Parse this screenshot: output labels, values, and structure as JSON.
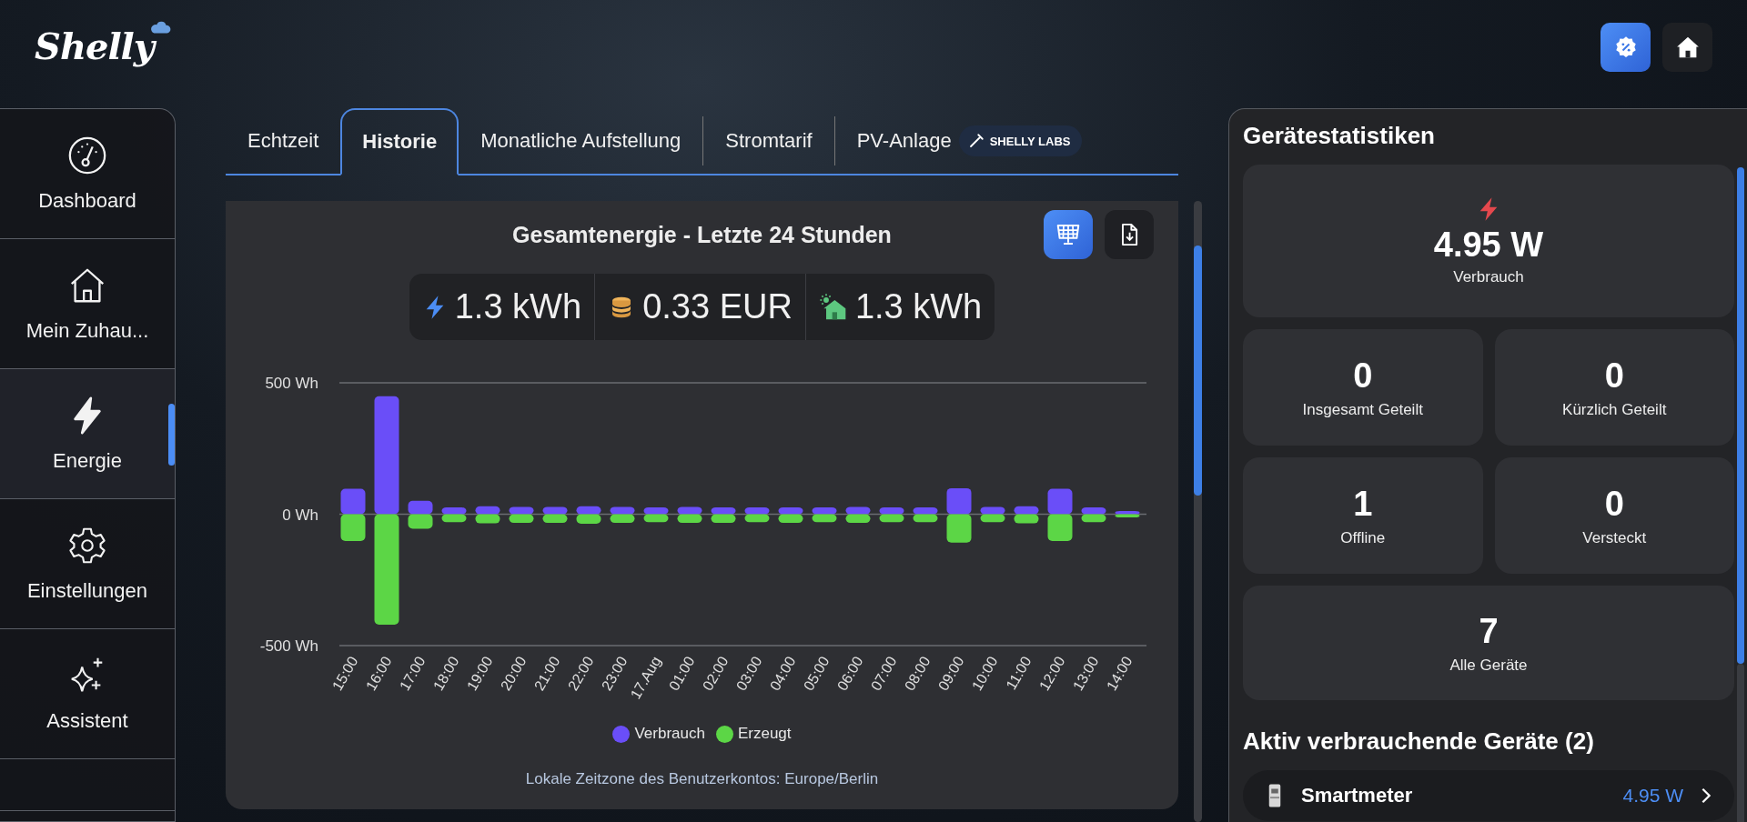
{
  "header": {
    "logo": "Shelly",
    "buttons": [
      {
        "kind": "offers",
        "selected": true
      },
      {
        "kind": "home",
        "selected": false
      }
    ]
  },
  "sidebar": {
    "items": [
      {
        "kind": "dashboard",
        "label": "Dashboard",
        "selected": false
      },
      {
        "kind": "home",
        "label": "Mein Zuhau...",
        "selected": false
      },
      {
        "kind": "energy",
        "label": "Energie",
        "selected": true
      },
      {
        "kind": "settings",
        "label": "Einstellungen",
        "selected": false
      },
      {
        "kind": "assistant",
        "label": "Assistent",
        "selected": false
      }
    ]
  },
  "tabs": [
    {
      "label": "Echtzeit",
      "selected": false
    },
    {
      "label": "Historie",
      "selected": true
    },
    {
      "label": "Monatliche Aufstellung",
      "selected": false
    },
    {
      "label": "Stromtarif",
      "selected": false
    },
    {
      "label": "PV-Anlage",
      "selected": false,
      "badge": "SHELLY LABS"
    }
  ],
  "chart_card": {
    "title": "Gesamtenergie - Letzte 24 Stunden",
    "buttons": [
      {
        "kind": "solar",
        "selected": true
      },
      {
        "kind": "download",
        "selected": false
      }
    ],
    "totals": [
      {
        "kind": "energy",
        "value": "1.3 kWh"
      },
      {
        "kind": "cost",
        "value": "0.33 EUR"
      },
      {
        "kind": "solar_home",
        "value": "1.3 kWh"
      }
    ],
    "chart_data": {
      "type": "bar",
      "categories": [
        "15:00",
        "16:00",
        "17:00",
        "18:00",
        "19:00",
        "20:00",
        "21:00",
        "22:00",
        "23:00",
        "17.Aug",
        "01:00",
        "02:00",
        "03:00",
        "04:00",
        "05:00",
        "06:00",
        "07:00",
        "08:00",
        "09:00",
        "10:00",
        "11:00",
        "12:00",
        "13:00",
        "14:00"
      ],
      "series": [
        {
          "name": "Verbrauch",
          "color": "#6a4ef8",
          "values": [
            97,
            449,
            51,
            26,
            30,
            28,
            28,
            30,
            28,
            26,
            28,
            26,
            26,
            26,
            26,
            28,
            26,
            26,
            99,
            28,
            30,
            97,
            26,
            12
          ]
        },
        {
          "name": "Erzeugt",
          "color": "#5cd646",
          "values": [
            -102,
            -420,
            -55,
            -30,
            -35,
            -33,
            -33,
            -36,
            -33,
            -30,
            -33,
            -33,
            -30,
            -33,
            -30,
            -33,
            -30,
            -30,
            -108,
            -30,
            -35,
            -102,
            -30,
            -12
          ]
        }
      ],
      "stacked": true,
      "ylim": [
        -500,
        500
      ],
      "yticks": [
        {
          "value": 500,
          "label": "500 Wh"
        },
        {
          "value": 0,
          "label": "0 Wh"
        },
        {
          "value": -500,
          "label": "-500 Wh"
        }
      ]
    },
    "footnote": "Lokale Zeitzone des Benutzerkontos: Europe/Berlin"
  },
  "stats": {
    "title": "Gerätestatistiken",
    "cards": [
      {
        "kind": "power",
        "value": "4.95 W",
        "label": "Verbrauch"
      },
      {
        "kind": "count",
        "value": "0",
        "label": "Insgesamt Geteilt"
      },
      {
        "kind": "count",
        "value": "0",
        "label": "Kürzlich Geteilt"
      },
      {
        "kind": "count",
        "value": "1",
        "label": "Offline"
      },
      {
        "kind": "count",
        "value": "0",
        "label": "Versteckt"
      },
      {
        "kind": "total",
        "value": "7",
        "label": "Alle Geräte"
      }
    ]
  },
  "active_devices": {
    "title": "Aktiv verbrauchende Geräte (2)",
    "items": [
      {
        "name": "Smartmeter",
        "power": "4.95 W"
      }
    ]
  }
}
